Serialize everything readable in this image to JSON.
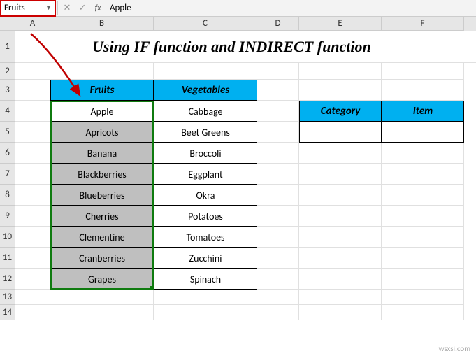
{
  "nameBox": "Fruits",
  "formulaBar": "Apple",
  "columns": [
    "A",
    "B",
    "C",
    "D",
    "E",
    "F"
  ],
  "rows": [
    "1",
    "2",
    "3",
    "4",
    "5",
    "6",
    "7",
    "8",
    "9",
    "10",
    "11",
    "12",
    "13",
    "14"
  ],
  "title": "Using IF function and INDIRECT function",
  "table1": {
    "headers": [
      "Fruits",
      "Vegetables"
    ],
    "data": [
      [
        "Apple",
        "Cabbage"
      ],
      [
        "Apricots",
        "Beet Greens"
      ],
      [
        "Banana",
        "Broccoli"
      ],
      [
        "Blackberries",
        "Eggplant"
      ],
      [
        "Blueberries",
        "Okra"
      ],
      [
        "Cherries",
        "Potatoes"
      ],
      [
        "Clementine",
        "Tomatoes"
      ],
      [
        "Cranberries",
        "Zucchini"
      ],
      [
        "Grapes",
        "Spinach"
      ]
    ]
  },
  "table2": {
    "headers": [
      "Category",
      "Item"
    ],
    "data": [
      [
        "",
        ""
      ]
    ]
  },
  "watermark": "wsxsi.com"
}
